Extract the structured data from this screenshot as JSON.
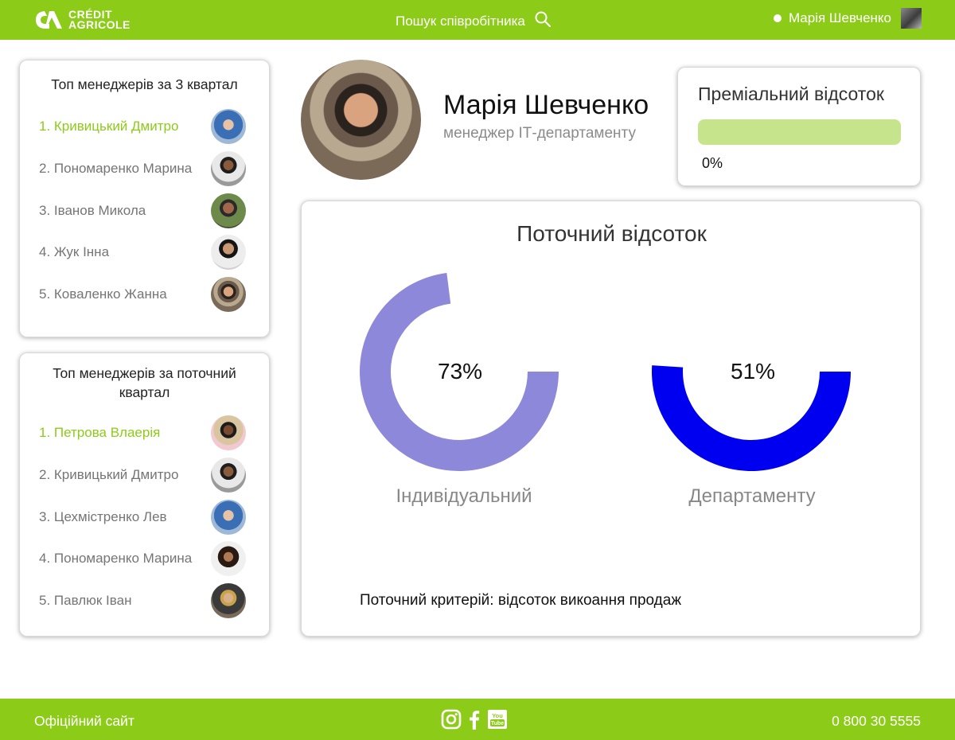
{
  "header": {
    "brand_line1": "CRÉDIT",
    "brand_line2": "AGRICOLE",
    "search_label": "Пошук співробітника",
    "user_name": "Марія Шевченко"
  },
  "sidebar": {
    "q3": {
      "title": "Топ менеджерів за 3 квартал",
      "items": [
        {
          "label": "1. Кривицький Дмитро"
        },
        {
          "label": "2. Пономаренко Марина"
        },
        {
          "label": "3. Іванов Микола"
        },
        {
          "label": "4. Жук Інна"
        },
        {
          "label": "5. Коваленко Жанна"
        }
      ]
    },
    "current": {
      "title": "Топ менеджерів за поточний квартал",
      "items": [
        {
          "label": "1. Петрова Влаерія"
        },
        {
          "label": "2. Кривицький Дмитро"
        },
        {
          "label": "3. Цехмістренко Лев"
        },
        {
          "label": "4. Пономаренко Марина"
        },
        {
          "label": "5. Павлюк Іван"
        }
      ]
    }
  },
  "profile": {
    "name": "Марія Шевченко",
    "role": "менеджер ІТ-департаменту"
  },
  "bonus": {
    "title": "Преміальний відсоток",
    "value_text": "0%",
    "progress": 0
  },
  "current_percent": {
    "title": "Поточний відсоток",
    "gauges": [
      {
        "label": "Індивідуальний",
        "value_text": "73%",
        "value": 73,
        "color": "#8e88da"
      },
      {
        "label": "Департаменту",
        "value_text": "51%",
        "value": 51,
        "color": "#0000f0"
      }
    ],
    "criteria": "Поточний критерій: відсоток викоання продаж"
  },
  "footer": {
    "site_link": "Офіційний сайт",
    "phone": "0 800 30 5555",
    "youtube_text_1": "You",
    "youtube_text_2": "Tube"
  },
  "colors": {
    "brand": "#8ccc18"
  }
}
